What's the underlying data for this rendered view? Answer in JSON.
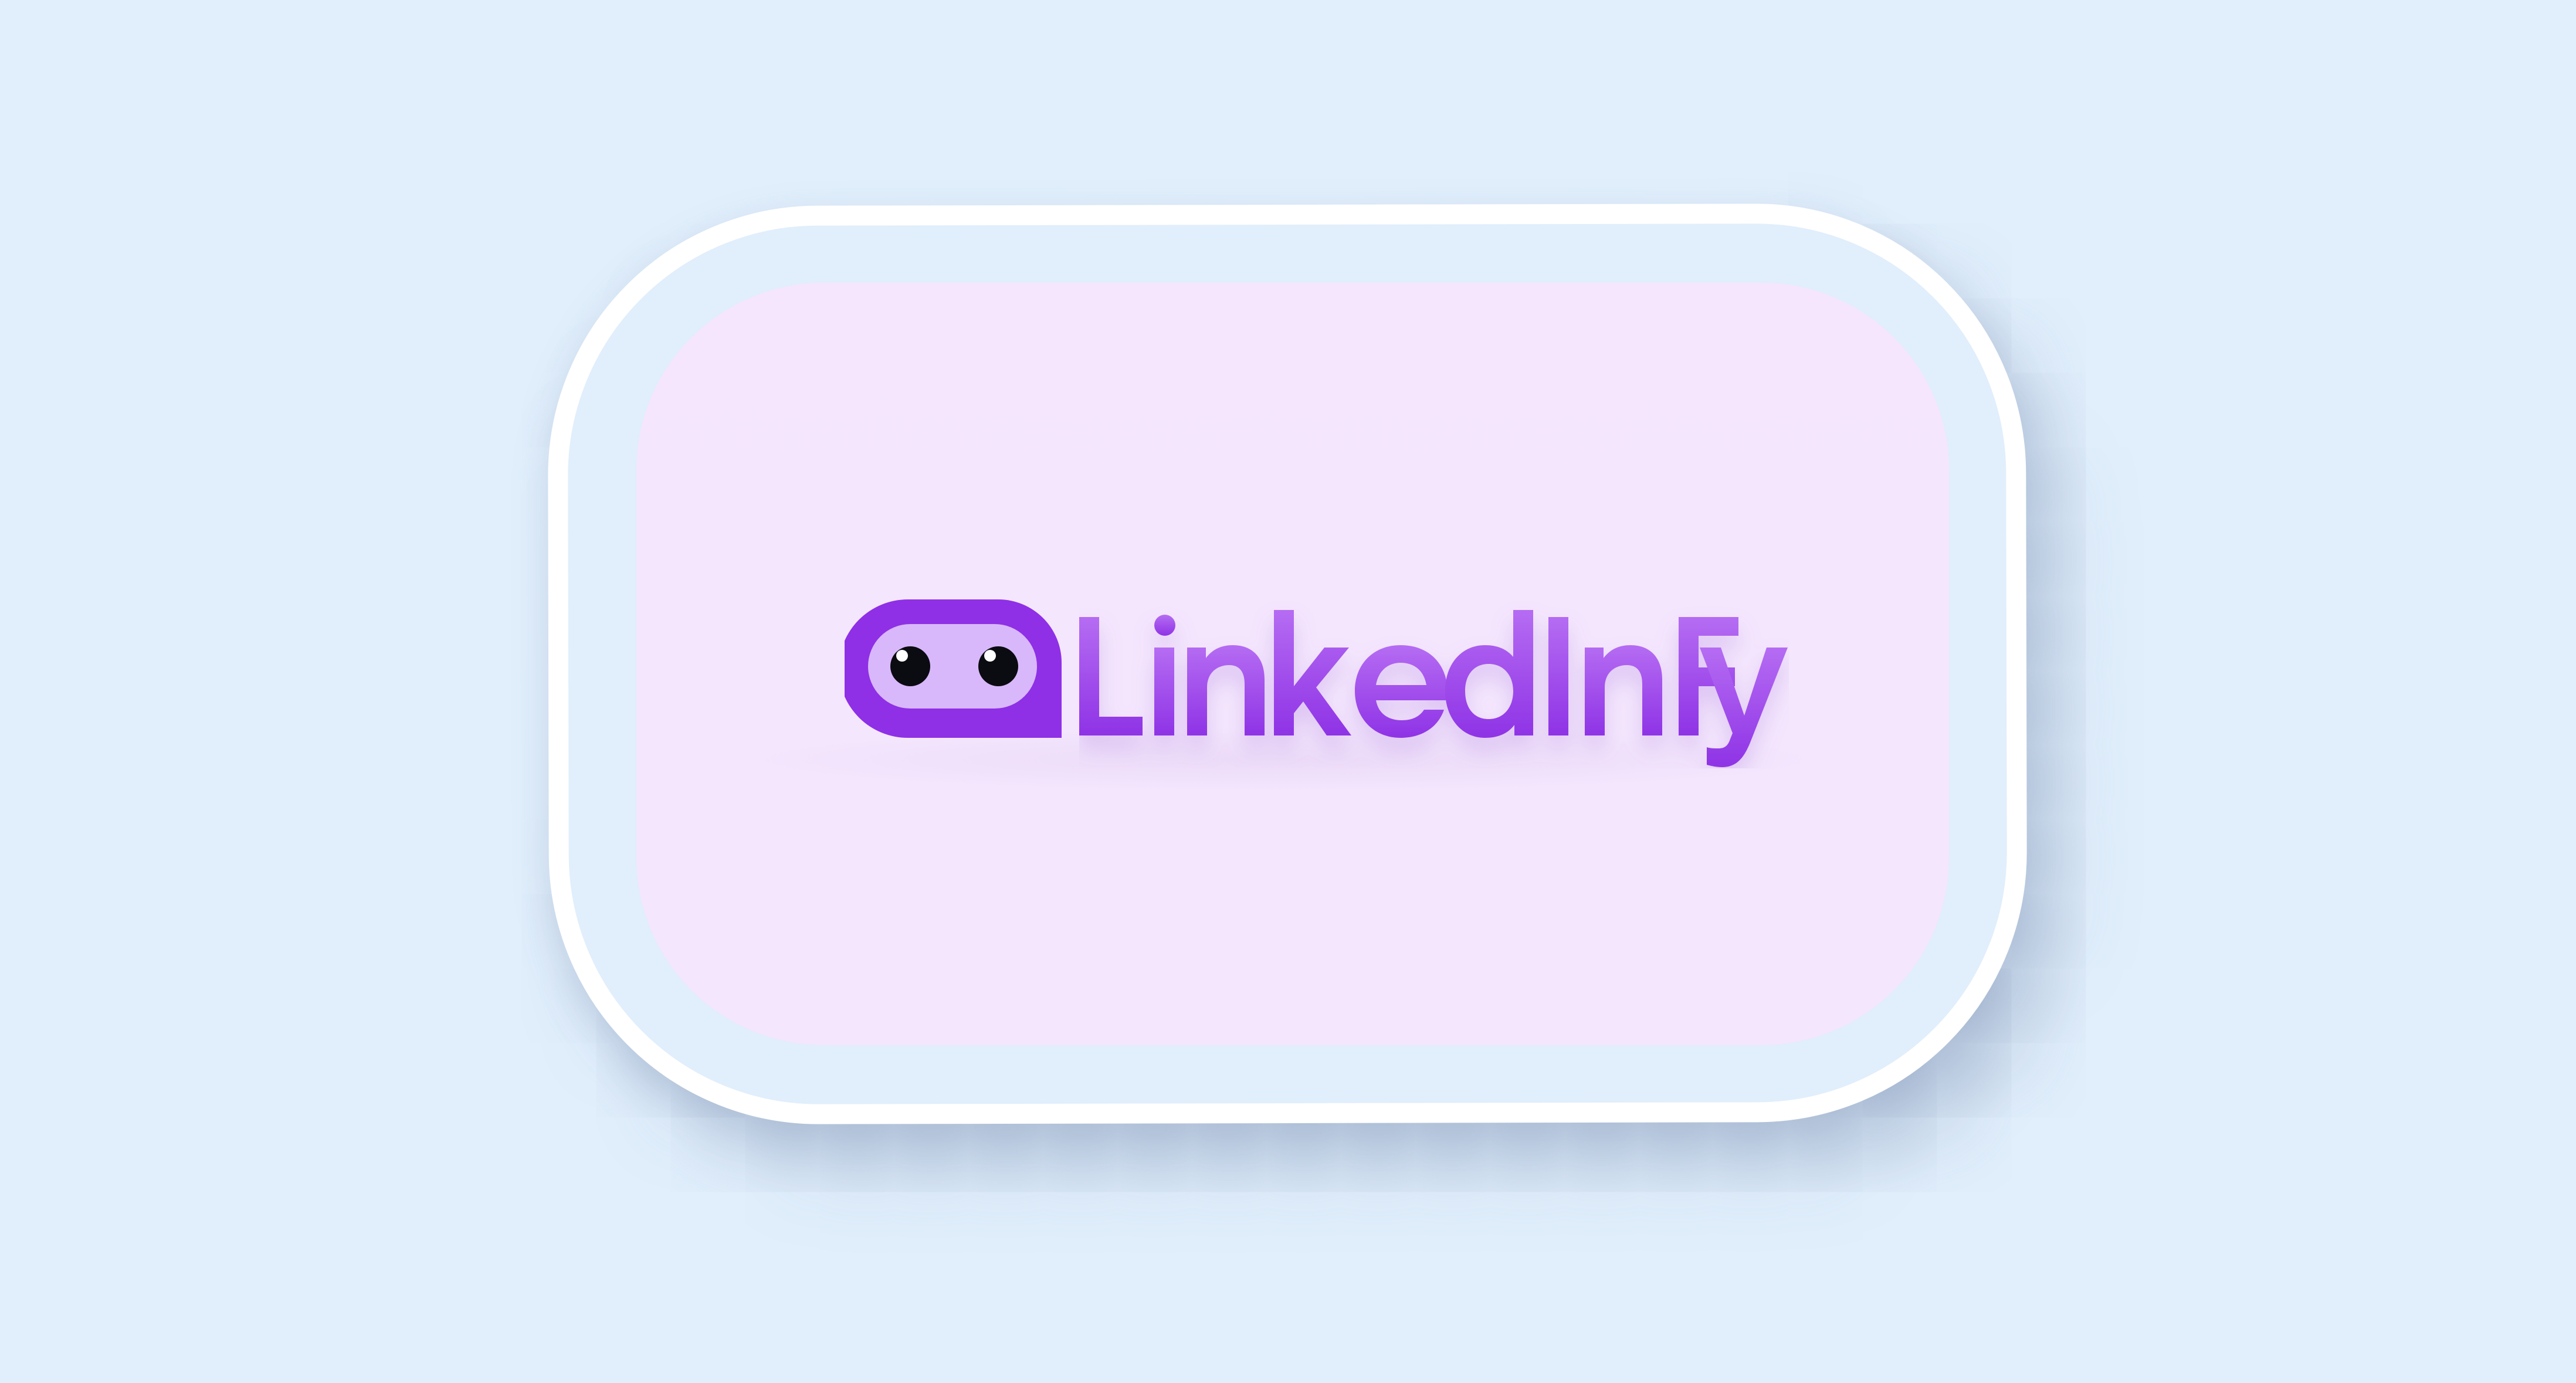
{
  "brand": {
    "name": "LinkedInFy",
    "colors": {
      "background": "#e1effc",
      "grid_line": "#f4f9ff",
      "card_border": "#ffffff",
      "card_fill": "#e1eefc",
      "inner_fill": "#f4e6fd",
      "logo_dark": "#8f2fe6",
      "logo_light": "#d8b8fb",
      "wordmark_top": "#b56cf2",
      "wordmark_bottom": "#8f33e6",
      "eye": "#0b0b12"
    },
    "icon": "robot-face-speech-bubble-icon"
  }
}
